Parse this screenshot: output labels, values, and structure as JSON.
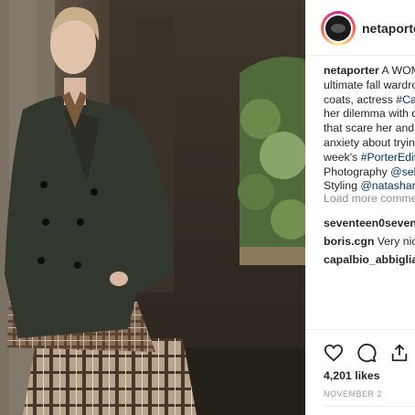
{
  "post": {
    "username": "netaporter",
    "caption_lines": [
      {
        "user": "netaporter",
        "text": " A WOM"
      },
      {
        "text": "ultimate fall wardro"
      },
      {
        "text": "coats, actress ",
        "tag": "#Car"
      },
      {
        "text": "her dilemma with d"
      },
      {
        "text": "that scare her and"
      },
      {
        "text": "anxiety about trying"
      },
      {
        "text": "week's ",
        "tag": "#PorterEdit"
      },
      {
        "text": "Photography ",
        "tag": "@seb"
      },
      {
        "text": "Styling ",
        "tag": "@natashard"
      }
    ],
    "load_more": "Load more comme",
    "comments": [
      {
        "user": "seventeen0seven",
        "text": ""
      },
      {
        "user": "boris.cgn",
        "text": " Very nice"
      },
      {
        "user": "capalbio_abbiglian",
        "text": ""
      }
    ],
    "likes": "4,201 likes",
    "date": "NOVEMBER 2"
  },
  "icons": {
    "like": "heart-icon",
    "comment": "comment-bubble-icon",
    "share": "share-icon"
  }
}
